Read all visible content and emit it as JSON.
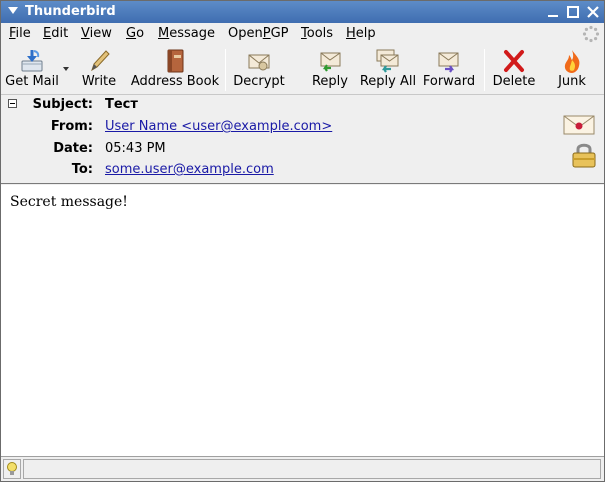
{
  "window": {
    "title": "Thunderbird"
  },
  "menu": {
    "items": [
      {
        "key": "F",
        "rest": "ile"
      },
      {
        "key": "E",
        "rest": "dit"
      },
      {
        "key": "V",
        "rest": "iew"
      },
      {
        "key": "G",
        "rest": "o"
      },
      {
        "key": "M",
        "rest": "essage"
      },
      {
        "key": "",
        "pre": "Open",
        "keyMid": "P",
        "rest": "GP"
      },
      {
        "key": "T",
        "rest": "ools"
      },
      {
        "key": "H",
        "rest": "elp"
      }
    ]
  },
  "toolbar": {
    "get_mail": "Get Mail",
    "write": "Write",
    "address_book": "Address Book",
    "decrypt": "Decrypt",
    "reply": "Reply",
    "reply_all": "Reply All",
    "forward": "Forward",
    "delete": "Delete",
    "junk": "Junk"
  },
  "header": {
    "subject_label": "Subject:",
    "subject": "Тест",
    "from_label": "From:",
    "from": "User Name <user@example.com>",
    "date_label": "Date:",
    "date": "05:43 PM",
    "to_label": "To:",
    "to": "some.user@example.com"
  },
  "body": {
    "text": "Secret message!"
  },
  "colors": {
    "titlebar": "#4a78bc",
    "link": "#1a1aa6"
  }
}
